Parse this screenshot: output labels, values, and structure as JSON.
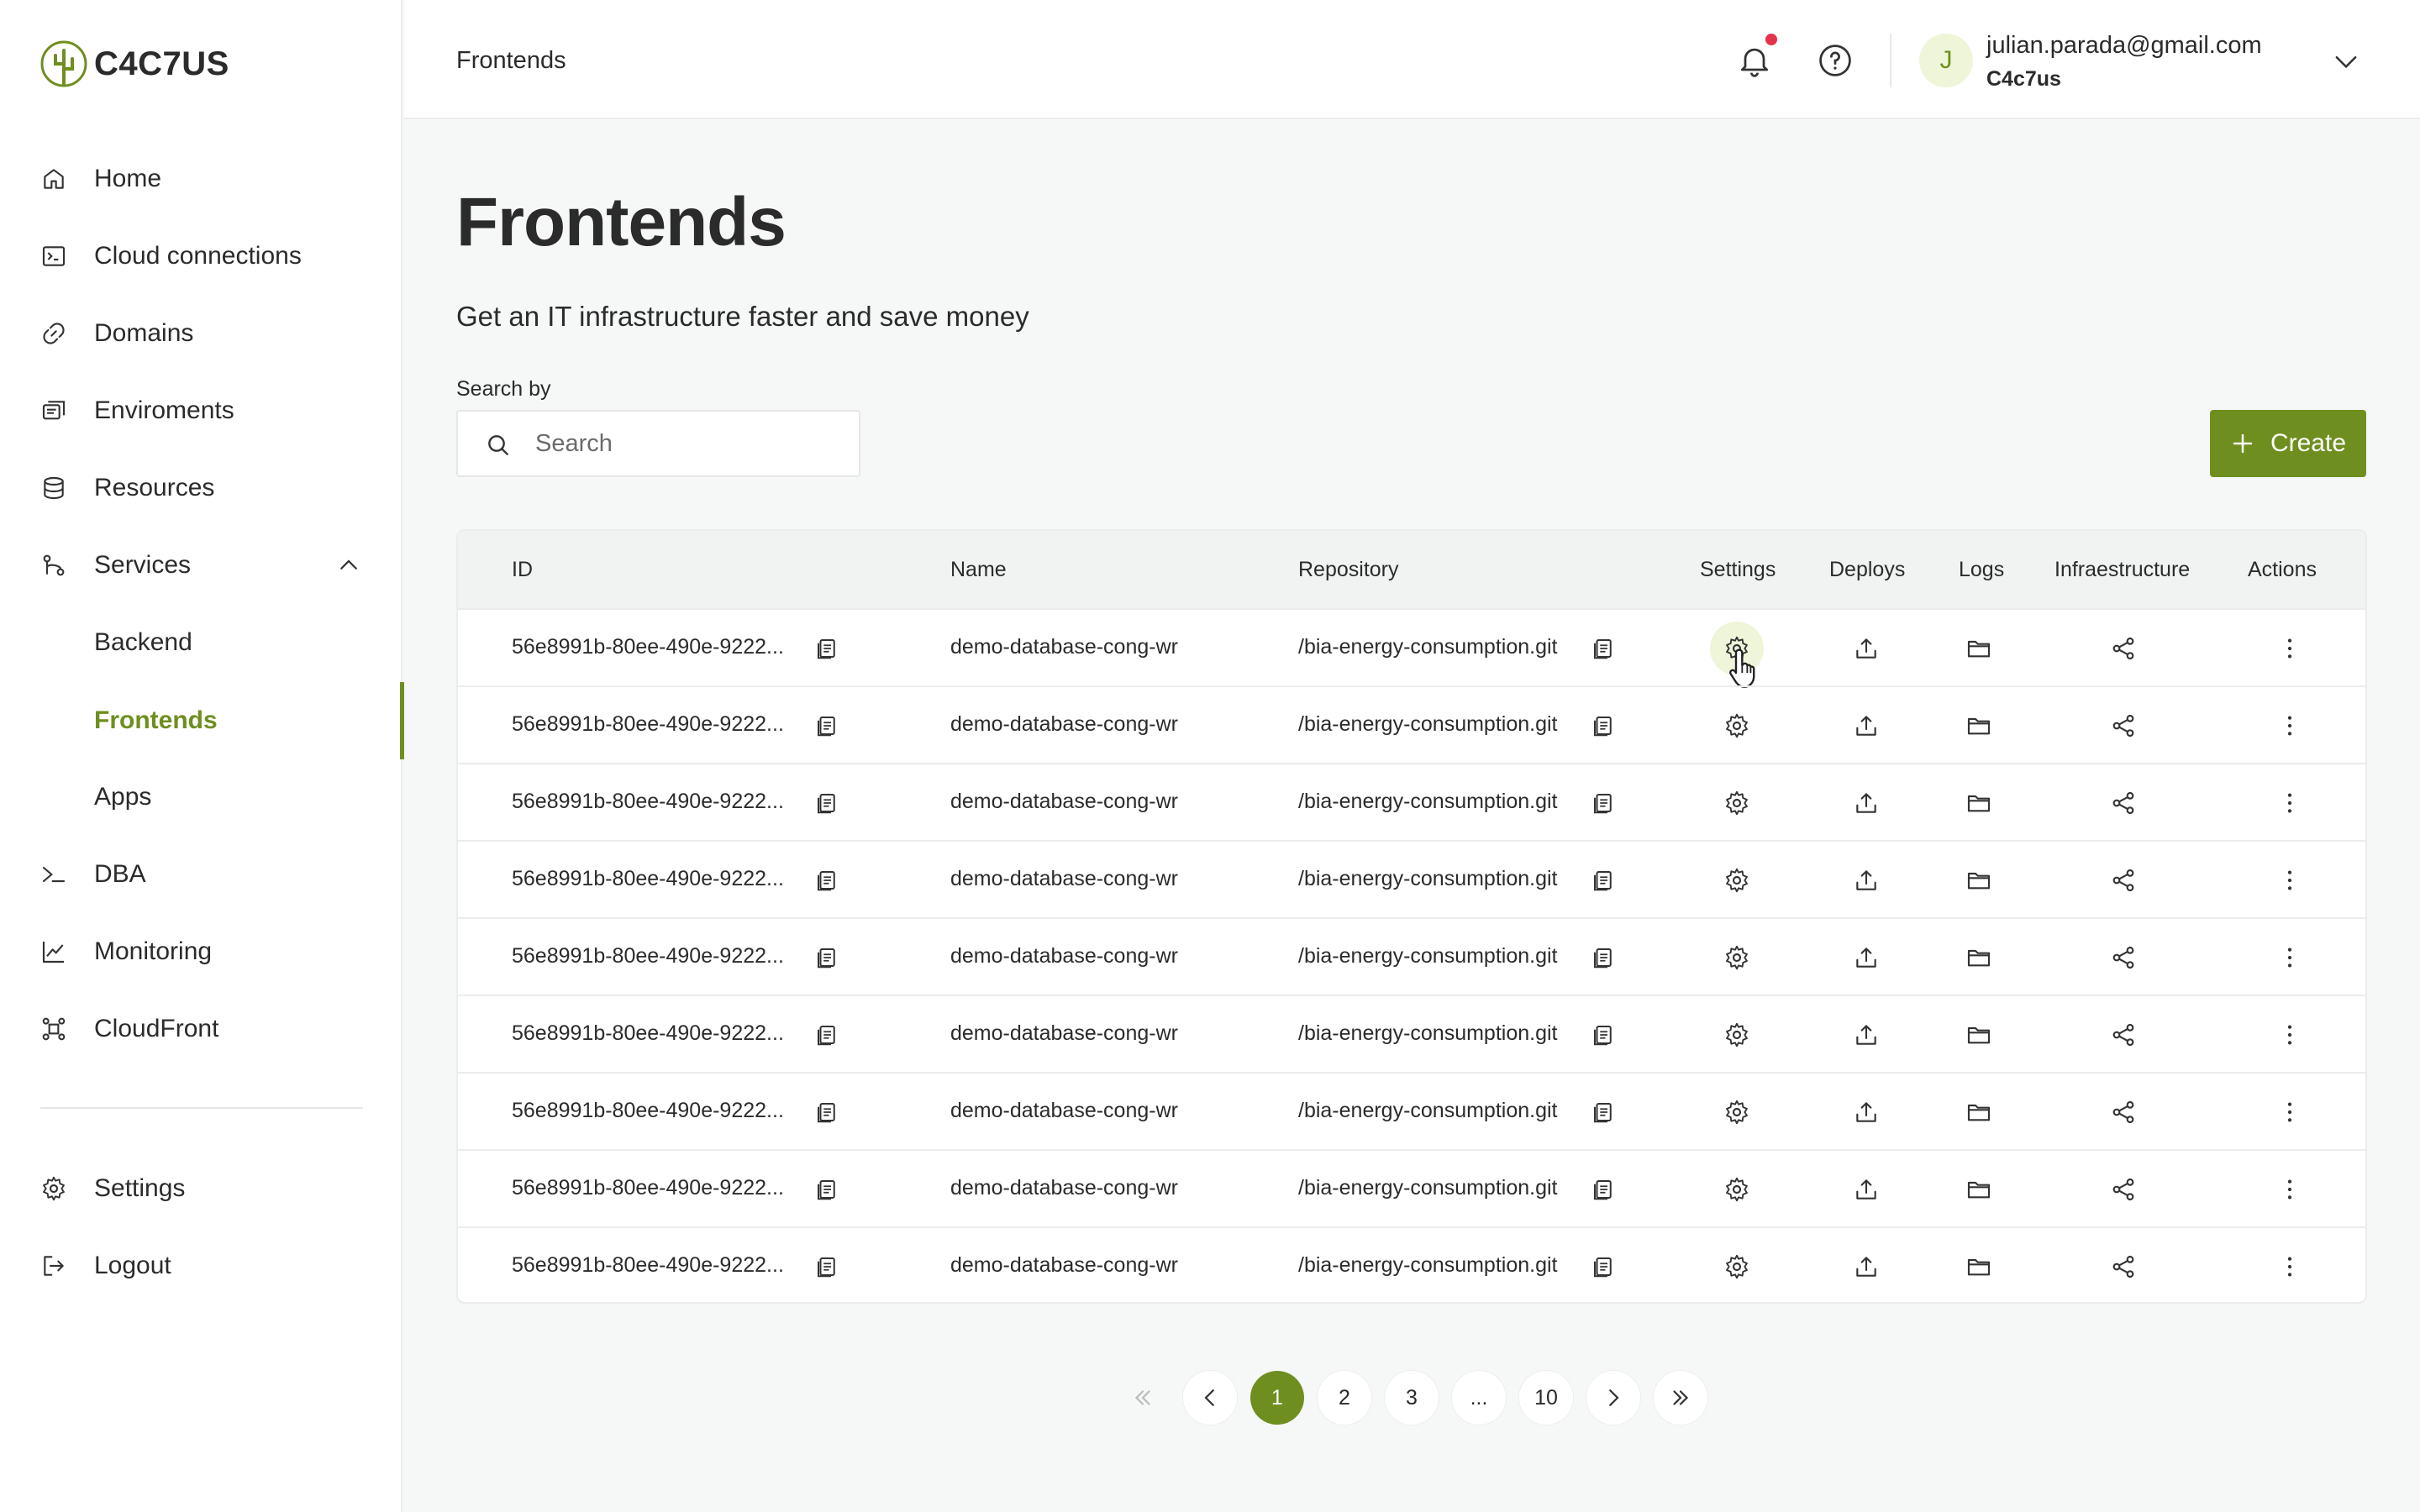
{
  "logo": {
    "text": "C4C7US"
  },
  "sidebar": {
    "items": [
      {
        "label": "Home",
        "icon": "home-icon"
      },
      {
        "label": "Cloud connections",
        "icon": "terminal-icon"
      },
      {
        "label": "Domains",
        "icon": "link-icon"
      },
      {
        "label": "Enviroments",
        "icon": "environment-icon"
      },
      {
        "label": "Resources",
        "icon": "database-icon"
      },
      {
        "label": "Services",
        "icon": "services-icon"
      },
      {
        "label": "Backend",
        "icon": ""
      },
      {
        "label": "Frontends",
        "icon": ""
      },
      {
        "label": "Apps",
        "icon": ""
      },
      {
        "label": "DBA",
        "icon": "prompt-icon"
      },
      {
        "label": "Monitoring",
        "icon": "chart-icon"
      },
      {
        "label": "CloudFront",
        "icon": "cloudfront-icon"
      }
    ],
    "bottom": [
      {
        "label": "Settings",
        "icon": "gear-icon"
      },
      {
        "label": "Logout",
        "icon": "logout-icon"
      }
    ]
  },
  "header": {
    "breadcrumb": "Frontends",
    "user": {
      "initial": "J",
      "email": "julian.parada@gmail.com",
      "org": "C4c7us"
    }
  },
  "main": {
    "title": "Frontends",
    "subtitle": "Get an IT infrastructure faster and save money",
    "search": {
      "label": "Search by",
      "placeholder": "Search"
    },
    "create_label": "Create"
  },
  "table": {
    "columns": [
      "ID",
      "Name",
      "Repository",
      "Settings",
      "Deploys",
      "Logs",
      "Infraestructure",
      "Actions"
    ],
    "rows": [
      {
        "id": "56e8991b-80ee-490e-9222...",
        "name": "demo-database-cong-wr",
        "repo": "/bia-energy-consumption.git"
      },
      {
        "id": "56e8991b-80ee-490e-9222...",
        "name": "demo-database-cong-wr",
        "repo": "/bia-energy-consumption.git"
      },
      {
        "id": "56e8991b-80ee-490e-9222...",
        "name": "demo-database-cong-wr",
        "repo": "/bia-energy-consumption.git"
      },
      {
        "id": "56e8991b-80ee-490e-9222...",
        "name": "demo-database-cong-wr",
        "repo": "/bia-energy-consumption.git"
      },
      {
        "id": "56e8991b-80ee-490e-9222...",
        "name": "demo-database-cong-wr",
        "repo": "/bia-energy-consumption.git"
      },
      {
        "id": "56e8991b-80ee-490e-9222...",
        "name": "demo-database-cong-wr",
        "repo": "/bia-energy-consumption.git"
      },
      {
        "id": "56e8991b-80ee-490e-9222...",
        "name": "demo-database-cong-wr",
        "repo": "/bia-energy-consumption.git"
      },
      {
        "id": "56e8991b-80ee-490e-9222...",
        "name": "demo-database-cong-wr",
        "repo": "/bia-energy-consumption.git"
      },
      {
        "id": "56e8991b-80ee-490e-9222...",
        "name": "demo-database-cong-wr",
        "repo": "/bia-energy-consumption.git"
      }
    ]
  },
  "pagination": {
    "pages": [
      "1",
      "2",
      "3",
      "...",
      "10"
    ],
    "current": "1"
  },
  "colors": {
    "accent": "#6e8f1f",
    "accent_light": "#eef5d9",
    "notification": "#e5334b"
  }
}
